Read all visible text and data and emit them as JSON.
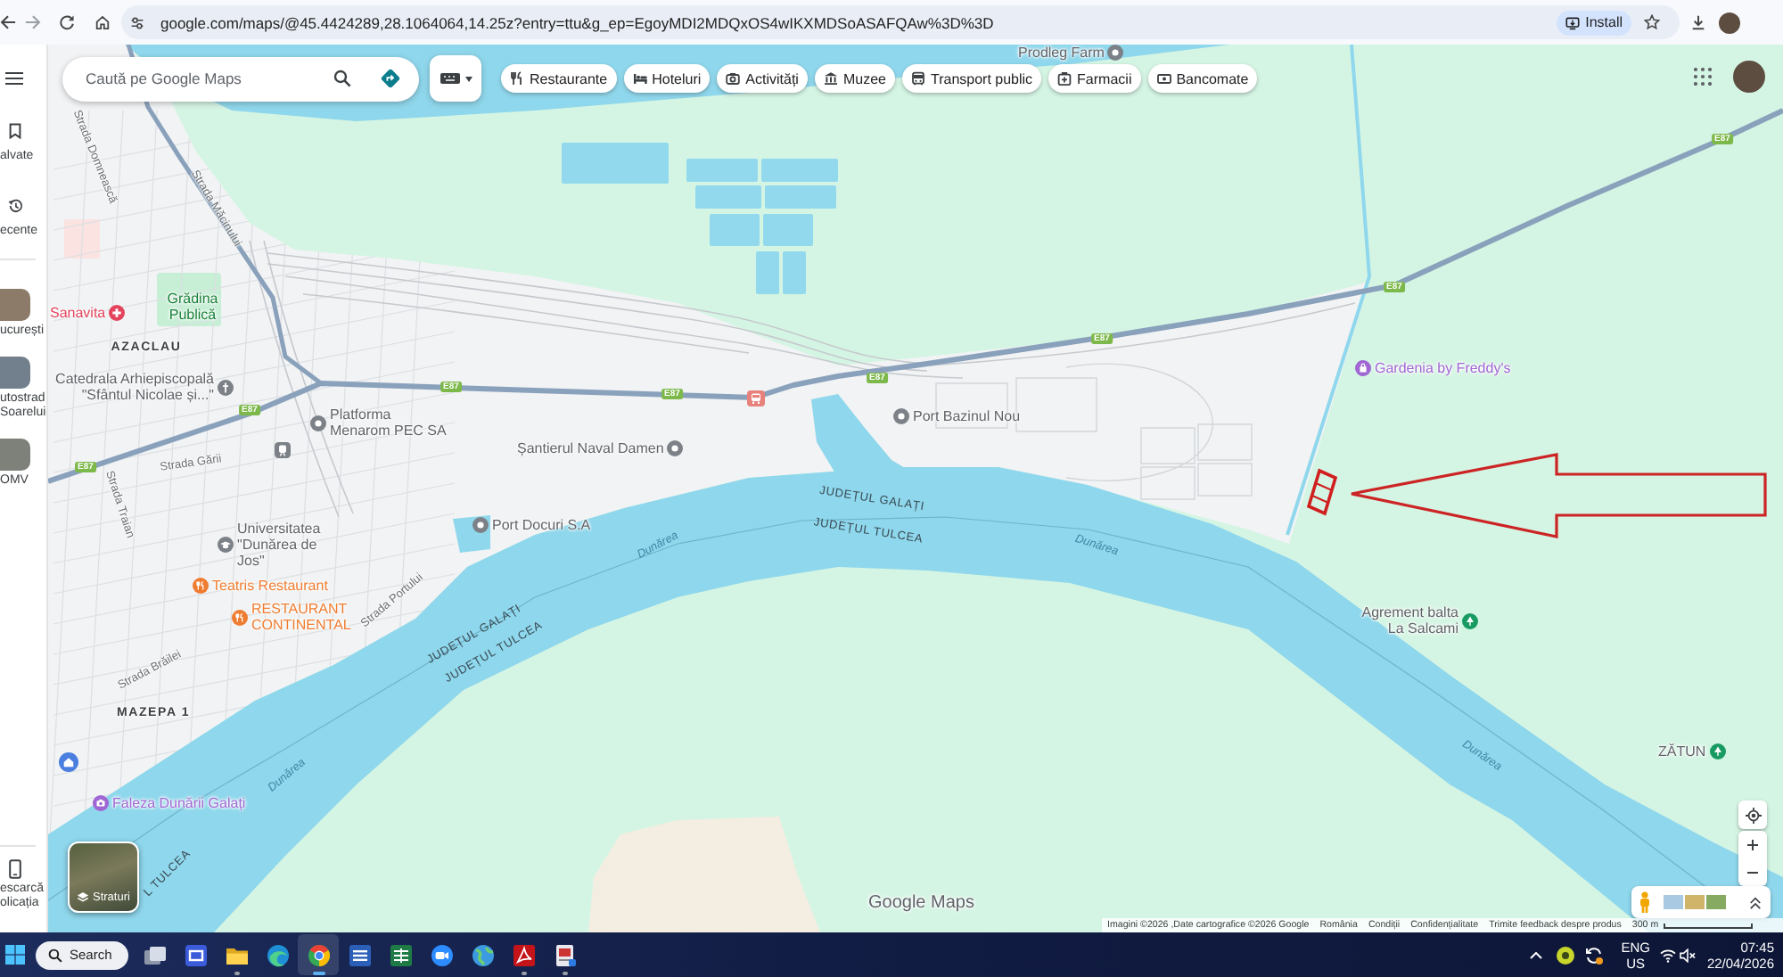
{
  "browser": {
    "url": "google.com/maps/@45.4424289,28.1064064,14.25z?entry=ttu&g_ep=EgoyMDI2MDQxOS4wIKXMDSoASAFQAw%3D%3D",
    "install_button": "Install"
  },
  "sidebar": {
    "items": [
      {
        "kind": "saved",
        "label": "alvate"
      },
      {
        "kind": "recent",
        "label": "ecente"
      },
      {
        "kind": "place",
        "label": "ucurești"
      },
      {
        "kind": "place",
        "label": "utostrad Soarelui"
      },
      {
        "kind": "place",
        "label": "OMV"
      }
    ],
    "download_app": "escarcă olicația"
  },
  "search": {
    "placeholder": "Caută pe Google Maps"
  },
  "chips": [
    {
      "kind": "restaurants",
      "label": "Restaurante"
    },
    {
      "kind": "hotels",
      "label": "Hoteluri"
    },
    {
      "kind": "activities",
      "label": "Activități"
    },
    {
      "kind": "museums",
      "label": "Muzee"
    },
    {
      "kind": "transit",
      "label": "Transport public"
    },
    {
      "kind": "pharmacies",
      "label": "Farmacii"
    },
    {
      "kind": "atms",
      "label": "Bancomate"
    }
  ],
  "map": {
    "places": [
      {
        "name": "Prodleg Farm",
        "kind": "generic",
        "color": "#7c8187"
      },
      {
        "name": "Sanavita",
        "kind": "hospital",
        "color": "#e4435c"
      },
      {
        "name": "Catedrala Arhiepiscopală \"Sfântul Nicolae și...\"",
        "kind": "church",
        "color": "#7c8187"
      },
      {
        "name": "Platforma Menarom PEC SA",
        "kind": "generic",
        "color": "#7c8187"
      },
      {
        "name": "Universitatea \"Dunărea de Jos\"",
        "kind": "school",
        "color": "#7c8187"
      },
      {
        "name": "Teatris Restaurant",
        "kind": "restaurant",
        "color": "#ef7d31"
      },
      {
        "name": "RESTAURANT CONTINENTAL",
        "kind": "restaurant",
        "color": "#ef7d31"
      },
      {
        "name": "Șantierul Naval Damen",
        "kind": "generic",
        "color": "#7c8187"
      },
      {
        "name": "Port Docuri S.A",
        "kind": "generic",
        "color": "#7c8187"
      },
      {
        "name": "Port Bazinul Nou",
        "kind": "generic",
        "color": "#7c8187"
      },
      {
        "name": "Gardenia by Freddy's",
        "kind": "shopping",
        "color": "#a066d3"
      },
      {
        "name": "Agrement balta La Salcami",
        "kind": "park",
        "color": "#189b62"
      },
      {
        "name": "ZĂTUN",
        "kind": "park",
        "color": "#189b62"
      },
      {
        "name": "Faleza Dunării Galați",
        "kind": "landmark",
        "color": "#a066d3"
      }
    ],
    "parks": [
      {
        "name": "Grădina Publică"
      }
    ],
    "areas": [
      {
        "name": "AZACLAU"
      },
      {
        "name": "MAZEPA 1"
      }
    ],
    "streets": [
      "Strada Domnească",
      "Strada Măcinului",
      "Strada Gării",
      "Strada Traian",
      "Strada Portului",
      "Strada Brăilei"
    ],
    "water_labels": [
      "Dunărea",
      "Dunărea",
      "Dunărea",
      "Dunărea"
    ],
    "boundary_labels": [
      "JUDEȚUL GALAȚI",
      "JUDEȚUL TULCEA",
      "JUDEȚUL GALAȚI",
      "JUDEȚUL TULCEA",
      "L TULCEA"
    ],
    "road_shields": [
      {
        "text": "E87",
        "color": "#7db84a"
      },
      {
        "text": "E87",
        "color": "#7db84a"
      },
      {
        "text": "E87",
        "color": "#7db84a"
      },
      {
        "text": "E87",
        "color": "#7db84a"
      },
      {
        "text": "E87",
        "color": "#7db84a"
      },
      {
        "text": "E87",
        "color": "#7db84a"
      },
      {
        "text": "E87",
        "color": "#7db84a"
      },
      {
        "text": "E87",
        "color": "#7db84a"
      }
    ]
  },
  "controls": {
    "layers_button": "Straturi"
  },
  "logo": "Google Maps",
  "footer": {
    "links": [
      "Imagini ©2026 ,Date cartografice ©2026 Google",
      "România",
      "Condiții",
      "Confidențialitate",
      "Trimite feedback despre produs"
    ],
    "scale": "300 m"
  },
  "taskbar": {
    "search_label": "Search",
    "apps": [
      {
        "kind": "task_view",
        "running": false,
        "selected": false
      },
      {
        "kind": "tile_app",
        "running": false,
        "selected": false
      },
      {
        "kind": "files",
        "running": true,
        "selected": false
      },
      {
        "kind": "edge",
        "running": false,
        "selected": false
      },
      {
        "kind": "chrome",
        "running": true,
        "selected": true
      },
      {
        "kind": "word",
        "running": false,
        "selected": false
      },
      {
        "kind": "excel",
        "running": false,
        "selected": false
      },
      {
        "kind": "video",
        "running": false,
        "selected": false
      },
      {
        "kind": "globe",
        "running": false,
        "selected": false
      },
      {
        "kind": "pdf",
        "running": true,
        "selected": false
      },
      {
        "kind": "doc_viewer",
        "running": true,
        "selected": false
      }
    ],
    "language": "ENG",
    "region": "US",
    "time": "07:45",
    "date": "22/04/2026"
  }
}
